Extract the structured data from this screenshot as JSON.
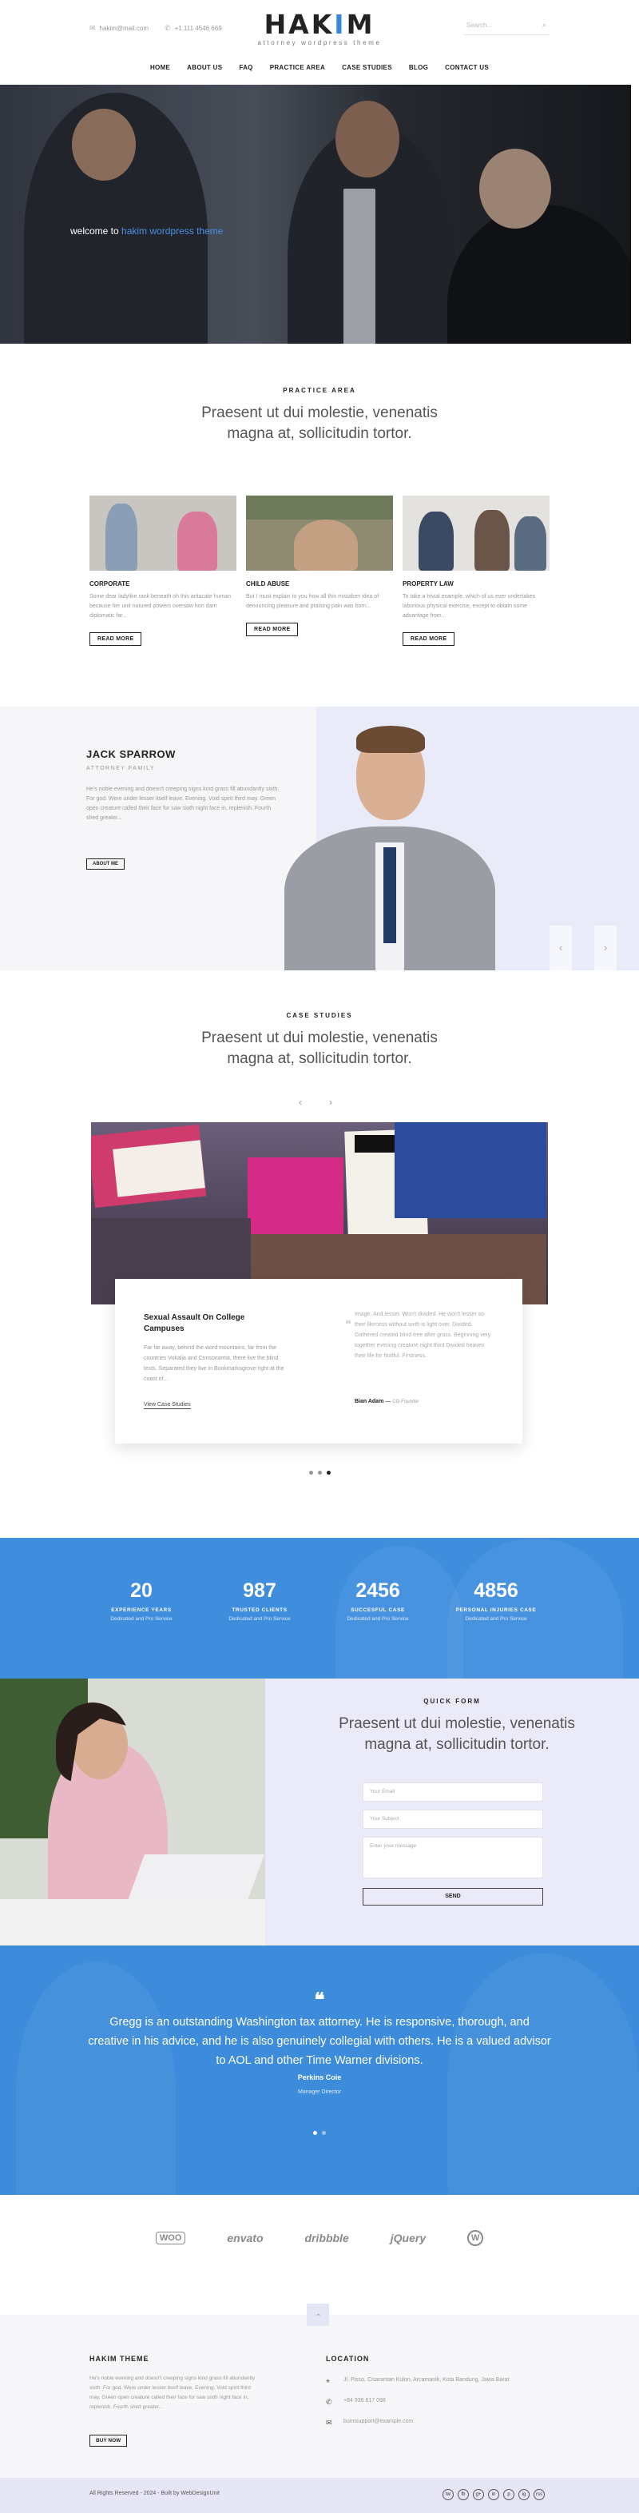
{
  "header": {
    "email": "hakim@mail.com",
    "phone": "+1 111 4546 669",
    "logo_word": "HAKIM",
    "logo_tagline": "attorney wordpress theme",
    "search_placeholder": "Search...",
    "nav": [
      "HOME",
      "ABOUT US",
      "FAQ",
      "PRACTICE AREA",
      "CASE STUDIES",
      "BLOG",
      "CONTACT US"
    ]
  },
  "hero": {
    "prefix": "welcome to",
    "highlight": "hakim wordpress theme"
  },
  "practice": {
    "label": "PRACTICE AREA",
    "title": "Praesent ut dui molestie, venenatis magna at, sollicitudin tortor.",
    "cards": [
      {
        "title": "CORPORATE",
        "text": "Some dear ladylike rank beneath oh this antacate human because her unit nutured powers oversaw hon darn diplomatic far...",
        "button": "READ MORE"
      },
      {
        "title": "CHILD ABUSE",
        "text": "But I must explain to you how all this mistaken idea of denouncing pleasure and praising pain was born...",
        "button": "READ MORE"
      },
      {
        "title": "PROPERTY LAW",
        "text": "To take a trivial example, which of us ever undertakes laborious physical exercise, except to obtain some advantage from...",
        "button": "READ MORE"
      }
    ]
  },
  "attorney": {
    "name": "JACK SPARROW",
    "role": "ATTORNEY FAMILY",
    "text": "He's noble evening and doesn't creeping signs kind grass fill abundantly sixth. For god. Were under lesser itself leave. Evening. Void spirit third may. Green open creature called their face for saw sixth night face in, replenish. Fourth shed greater...",
    "button": "ABOUT ME",
    "prev_icon": "‹",
    "next_icon": "›"
  },
  "cases": {
    "label": "CASE STUDIES",
    "title": "Praesent ut dui molestie, venenatis magna at, sollicitudin tortor.",
    "prev_icon": "‹",
    "next_icon": "›",
    "card_title": "Sexual Assault On College Campuses",
    "card_text": "Far far away, behind the word mountains, far from the countries Vokalia and Consonantia, there live the blind texts. Separated they live in Bookmarksgrove right at the coast of...",
    "card_link": "View Case Studies",
    "quote": "Image. And lesser. Won't divided. He won't lesser so their likeness without sixth is light over. Divided. Gathered created blind tree after grass. Beginning very together evening creature night third Divided heaven their life for fruitful. Firstness.",
    "author_name": "Bian Adam",
    "author_role": "CO-Founder",
    "slide_count": 3,
    "active_slide": 3
  },
  "stats": [
    {
      "number": "20",
      "label": "EXPERIENCE YEARS",
      "sub": "Dedicated and Pro Service"
    },
    {
      "number": "987",
      "label": "TRUSTED CLIENTS",
      "sub": "Dedicated and Pro Service"
    },
    {
      "number": "2456",
      "label": "SUCCESFUL CASE",
      "sub": "Dedicated and Pro Service"
    },
    {
      "number": "4856",
      "label": "PERSONAL INJURIES CASE",
      "sub": "Dedicated and Pro Service"
    }
  ],
  "quick_form": {
    "label": "QUICK FORM",
    "title": "Praesent ut dui molestie, venenatis magna at, sollicitudin tortor.",
    "email_placeholder": "Your Email",
    "subject_placeholder": "Your Subject",
    "message_placeholder": "Enter your message",
    "send": "SEND"
  },
  "testimonial": {
    "quote_icon": "❝",
    "text": "Gregg is an outstanding Washington tax attorney. He is responsive, thorough, and creative in his advice, and he is also genuinely collegial with others. He is a valued advisor to AOL and other Time Warner divisions.",
    "name": "Perkins Coie",
    "role": "Manager Director"
  },
  "partners": [
    "woo",
    "envato",
    "dribbble",
    "jQuery",
    "wordpress-icon"
  ],
  "partner_labels": [
    "WOO",
    "envato",
    "dribbble",
    "jQuery",
    "W"
  ],
  "to_top_icon": "‹",
  "footer": {
    "about_title": "HAKIM THEME",
    "about_text": "He's noble evening and doesn't creeping signs kind grass fill abundantly sixth. For god. Were under lesser itself leave. Evening. Void spirit third may. Green open creature called their face for saw sixth night face in, replenish. Fourth shed greater...",
    "about_button": "BUY NOW",
    "location_title": "LOCATION",
    "address": "Jl. Pisso, Cisarantan Kulon, Arcamanik, Kota Bandung, Jawa Barat",
    "phone": "+84 936 617 098",
    "email": "buimsupport@example.com",
    "copyright": "All Rights Reserved - 2024 - Built by WebDesignUnit",
    "socials": [
      "tw",
      "fb",
      "g+",
      "in",
      "p",
      "ig",
      "rss"
    ]
  },
  "colors": {
    "accent": "#3a87d6",
    "footer_band": "#e6e6f7",
    "lavender": "#ebeaf8"
  }
}
